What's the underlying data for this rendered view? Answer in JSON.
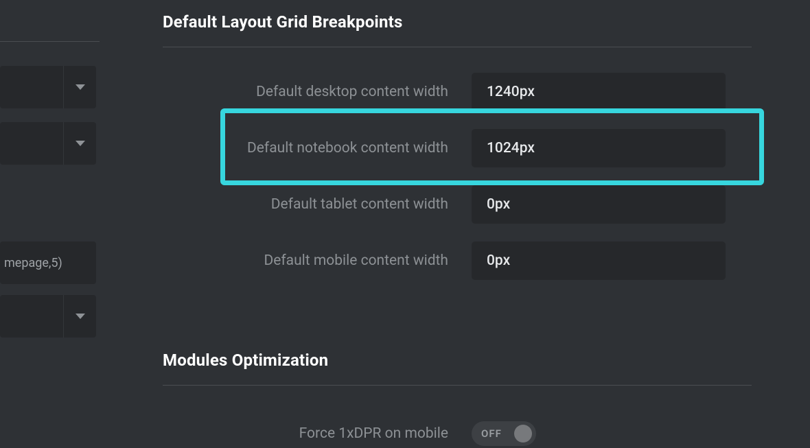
{
  "sidebar": {
    "chip_text": "mepage,5)"
  },
  "breakpoints": {
    "title": "Default Layout Grid Breakpoints",
    "rows": [
      {
        "label": "Default desktop content width",
        "value": "1240px"
      },
      {
        "label": "Default notebook content width",
        "value": "1024px"
      },
      {
        "label": "Default tablet content width",
        "value": "0px"
      },
      {
        "label": "Default mobile content width",
        "value": "0px"
      }
    ],
    "highlighted_index": 1
  },
  "modules": {
    "title": "Modules Optimization",
    "force_dpr_label": "Force 1xDPR on mobile",
    "force_dpr_state": "OFF"
  }
}
